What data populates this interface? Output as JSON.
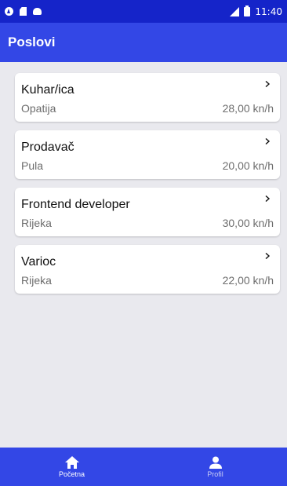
{
  "status_bar": {
    "time": "11:40",
    "icons": [
      "nav-circle-icon",
      "sd-card-icon",
      "android-icon",
      "signal-icon",
      "battery-icon"
    ]
  },
  "app_bar": {
    "title": "Poslovi"
  },
  "jobs": [
    {
      "title": "Kuhar/ica",
      "city": "Opatija",
      "rate": "28,00 kn/h"
    },
    {
      "title": "Prodavač",
      "city": "Pula",
      "rate": "20,00 kn/h"
    },
    {
      "title": "Frontend developer",
      "city": "Rijeka",
      "rate": "30,00 kn/h"
    },
    {
      "title": "Varioc",
      "city": "Rijeka",
      "rate": "22,00 kn/h"
    }
  ],
  "bottom_nav": {
    "items": [
      {
        "label": "Početna",
        "icon": "home-icon",
        "active": true
      },
      {
        "label": "Profil",
        "icon": "person-icon",
        "active": false
      }
    ]
  },
  "colors": {
    "status_bar": "#1524c9",
    "primary": "#3347e6",
    "background": "#e9e9ee",
    "card": "#ffffff",
    "text_primary": "#111111",
    "text_secondary": "#6d6d6d"
  }
}
